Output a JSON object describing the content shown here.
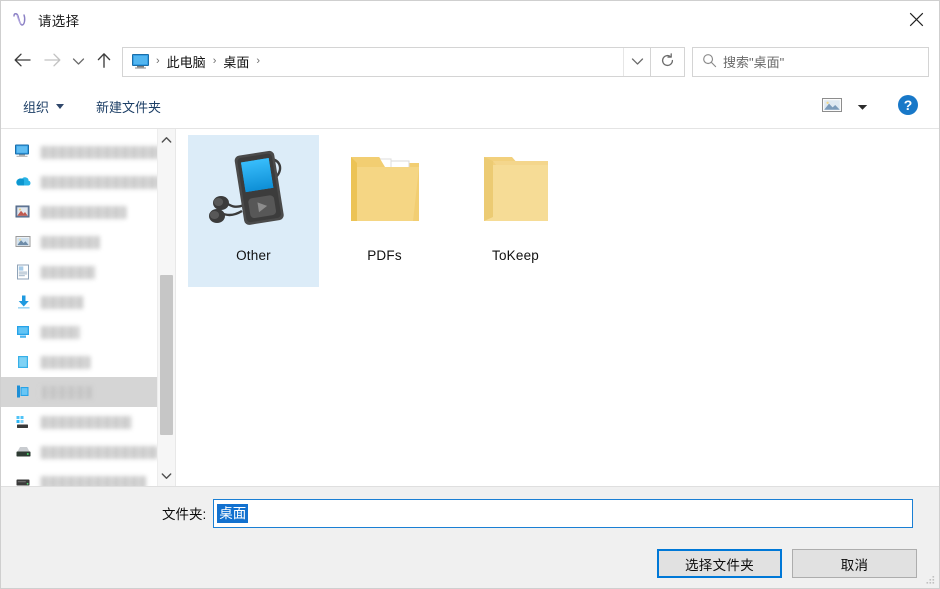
{
  "window": {
    "title": "请选择",
    "title_icon": "app-script-icon",
    "close_icon": "close-icon"
  },
  "nav": {
    "back_icon": "arrow-left-icon",
    "forward_icon": "arrow-right-icon",
    "recent_icon": "chevron-down-icon",
    "up_icon": "arrow-up-icon",
    "refresh_icon": "refresh-icon",
    "address_dropdown_icon": "chevron-down-icon"
  },
  "breadcrumb": {
    "computer_icon": "this-pc-monitor-icon",
    "items": [
      "此电脑",
      "桌面"
    ],
    "separator": "›"
  },
  "search": {
    "icon": "search-icon",
    "placeholder": "搜索\"桌面\""
  },
  "toolbar": {
    "organize_label": "组织",
    "new_folder_label": "新建文件夹",
    "view_icon": "view-thumbnails-icon",
    "view_caret_icon": "chevron-down-icon",
    "help_icon": "help-question-icon"
  },
  "nav_pane": {
    "items": [
      {
        "icon": "monitor-icon",
        "label_width": 148,
        "selected": false
      },
      {
        "icon": "onedrive-icon",
        "label_width": 133,
        "selected": false
      },
      {
        "icon": "pictures-folder-icon",
        "label_width": 86,
        "selected": false
      },
      {
        "icon": "photo-icon",
        "label_width": 60,
        "selected": false
      },
      {
        "icon": "document-icon",
        "label_width": 55,
        "selected": false
      },
      {
        "icon": "downloads-icon",
        "label_width": 44,
        "selected": false
      },
      {
        "icon": "desktop-blue-icon",
        "label_width": 40,
        "selected": false
      },
      {
        "icon": "music-icon",
        "label_width": 50,
        "selected": false
      },
      {
        "icon": "this-pc-icon",
        "label_width": 52,
        "selected": true
      },
      {
        "icon": "apps-icon",
        "label_width": 92,
        "selected": false
      },
      {
        "icon": "drive-icon",
        "label_width": 118,
        "selected": false
      },
      {
        "icon": "drive-icon",
        "label_width": 106,
        "selected": false
      },
      {
        "icon": "network-icon",
        "label_width": 100,
        "selected": false
      }
    ],
    "scrollbar": {
      "up_arrow_icon": "chevron-up-icon",
      "down_arrow_icon": "chevron-down-icon"
    }
  },
  "files": [
    {
      "name": "Other",
      "icon": "media-player-folder-icon",
      "selected": true
    },
    {
      "name": "PDFs",
      "icon": "chrome-files-folder-icon",
      "selected": false
    },
    {
      "name": "ToKeep",
      "icon": "empty-folder-icon",
      "selected": false
    }
  ],
  "footer": {
    "folder_label": "文件夹:",
    "folder_value": "桌面",
    "select_button": "选择文件夹",
    "cancel_button": "取消",
    "resize_grip_icon": "resize-grip-icon"
  },
  "colors": {
    "accent": "#0078d7",
    "selection_blue": "#1271cf",
    "file_selected_bg": "#dcecf8",
    "tree_selected_bg": "#d5d5d5",
    "footer_bg": "#f0f0f0",
    "link_text": "#1d3f66"
  }
}
